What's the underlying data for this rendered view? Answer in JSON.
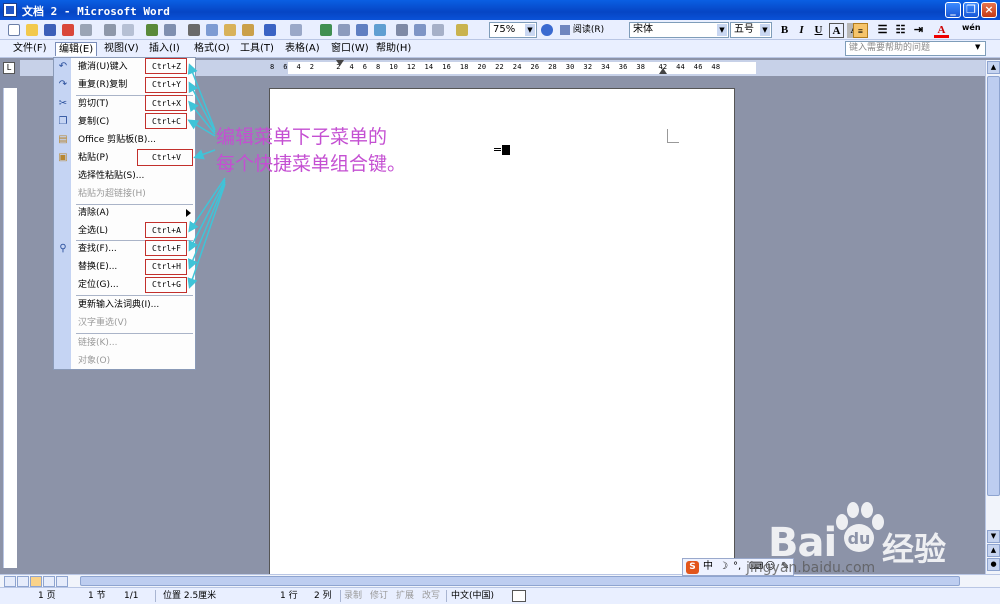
{
  "window": {
    "title": "文档 2 - Microsoft Word",
    "controls": [
      "minimize-icon",
      "restore-icon",
      "close-icon"
    ]
  },
  "toolbar": {
    "zoom": "75%",
    "read_label": "阅读(R)",
    "font_name": "宋体",
    "font_size": "五号",
    "bold": "B",
    "italic": "I",
    "underline": "U",
    "char_border": "A",
    "char_shade": "A",
    "font_color_label": "A",
    "phonetic": "wén"
  },
  "menubar": {
    "items": [
      {
        "label": "文件(F)"
      },
      {
        "label": "编辑(E)"
      },
      {
        "label": "视图(V)"
      },
      {
        "label": "插入(I)"
      },
      {
        "label": "格式(O)"
      },
      {
        "label": "工具(T)"
      },
      {
        "label": "表格(A)"
      },
      {
        "label": "窗口(W)"
      },
      {
        "label": "帮助(H)"
      }
    ],
    "help_placeholder": "键入需要帮助的问题"
  },
  "ruler": {
    "numbers": "8  6  4  2     2  4  6  8  10  12  14  16  18  20  22  24  26  28  30  32  34  36  38   42  44  46  48"
  },
  "edit_menu": {
    "items": [
      {
        "label": "撤消(U)键入",
        "shortcut": "Ctrl+Z",
        "icon": "undo-icon",
        "enabled": true
      },
      {
        "label": "重复(R)复制",
        "shortcut": "Ctrl+Y",
        "icon": "redo-icon",
        "enabled": true
      },
      {
        "label": "剪切(T)",
        "shortcut": "Ctrl+X",
        "icon": "cut-icon",
        "enabled": true
      },
      {
        "label": "复制(C)",
        "shortcut": "Ctrl+C",
        "icon": "copy-icon",
        "enabled": true
      },
      {
        "label": "Office 剪贴板(B)...",
        "shortcut": "",
        "icon": "clipboard-icon",
        "enabled": true
      },
      {
        "label": "粘贴(P)",
        "shortcut": "Ctrl+V",
        "icon": "paste-icon",
        "enabled": true
      },
      {
        "label": "选择性粘贴(S)...",
        "shortcut": "",
        "enabled": true
      },
      {
        "label": "粘贴为超链接(H)",
        "shortcut": "",
        "enabled": false
      },
      {
        "label": "清除(A)",
        "shortcut": "",
        "enabled": true,
        "submenu": true
      },
      {
        "label": "全选(L)",
        "shortcut": "Ctrl+A",
        "enabled": true
      },
      {
        "label": "查找(F)...",
        "shortcut": "Ctrl+F",
        "icon": "find-icon",
        "enabled": true
      },
      {
        "label": "替换(E)...",
        "shortcut": "Ctrl+H",
        "enabled": true
      },
      {
        "label": "定位(G)...",
        "shortcut": "Ctrl+G",
        "enabled": true
      },
      {
        "label": "更新输入法词典(I)...",
        "shortcut": "",
        "enabled": true
      },
      {
        "label": "汉字重选(V)",
        "shortcut": "",
        "enabled": false
      },
      {
        "label": "链接(K)...",
        "shortcut": "",
        "enabled": false
      },
      {
        "label": "对象(O)",
        "shortcut": "",
        "enabled": false
      }
    ]
  },
  "annotation": {
    "line1": "编辑菜单下子菜单的",
    "line2": "每个快捷菜单组合键。",
    "color": "#c44fd2",
    "arrow_color": "#3fc4d8"
  },
  "statusbar": {
    "page": "1 页",
    "section": "1 节",
    "page_of": "1/1",
    "position": "位置 2.5厘米",
    "line": "1 行",
    "column": "2 列",
    "rec": "录制",
    "trk": "修订",
    "ext": "扩展",
    "ovr": "改写",
    "language": "中文(中国)"
  },
  "ime": {
    "logo": "S",
    "mode": "中"
  },
  "watermark": {
    "brand": "Bai",
    "brand2": "经验",
    "url": "jingyan.baidu.com"
  }
}
